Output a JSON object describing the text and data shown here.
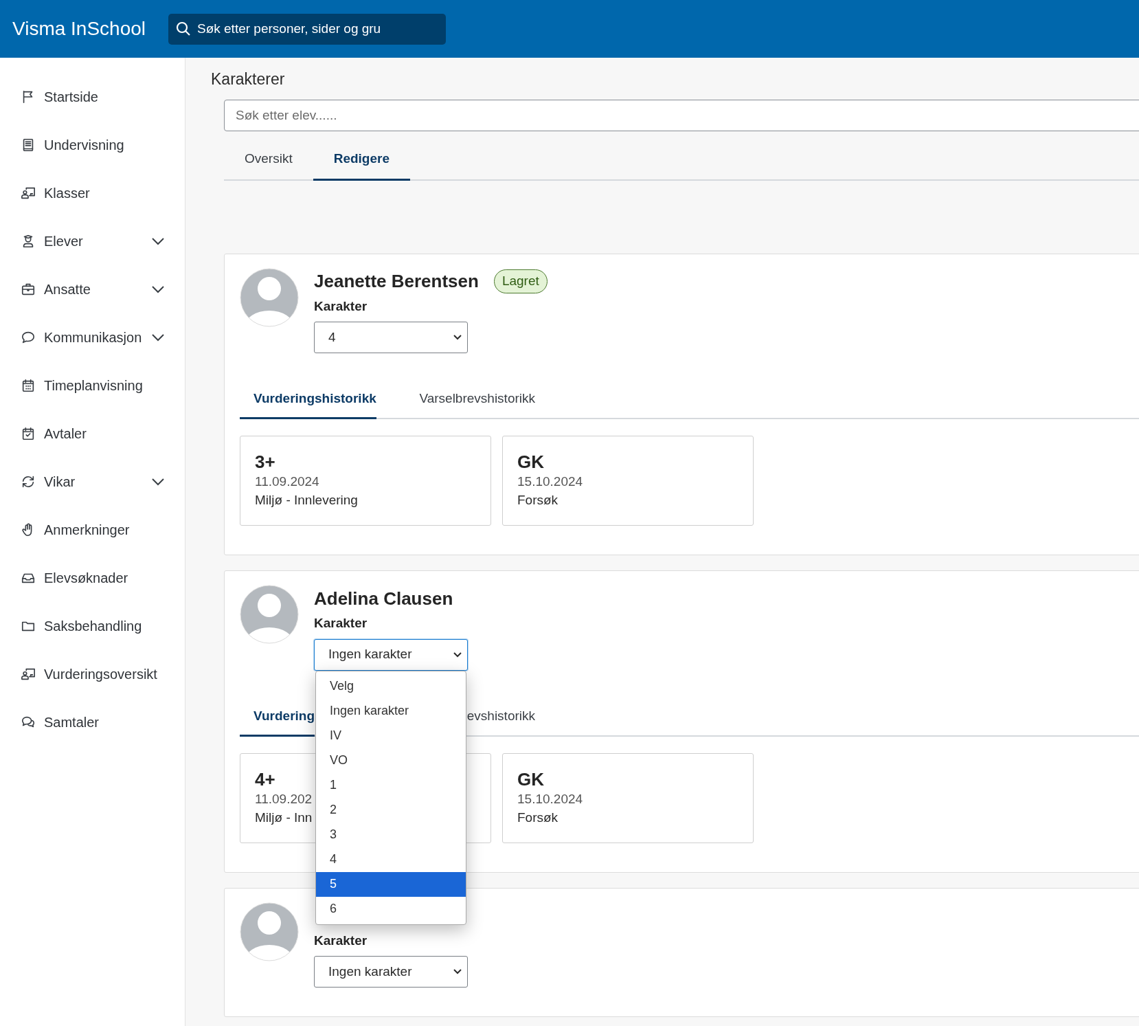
{
  "header": {
    "app_title": "Visma InSchool",
    "search": {
      "placeholder": "Søk etter personer, sider og gru"
    }
  },
  "sidebar": {
    "items": [
      {
        "label": "Startside",
        "has_children": false
      },
      {
        "label": "Undervisning",
        "has_children": false
      },
      {
        "label": "Klasser",
        "has_children": false
      },
      {
        "label": "Elever",
        "has_children": true
      },
      {
        "label": "Ansatte",
        "has_children": true
      },
      {
        "label": "Kommunikasjon",
        "has_children": true
      },
      {
        "label": "Timeplanvisning",
        "has_children": false
      },
      {
        "label": "Avtaler",
        "has_children": false
      },
      {
        "label": "Vikar",
        "has_children": true
      },
      {
        "label": "Anmerkninger",
        "has_children": false
      },
      {
        "label": "Elevsøknader",
        "has_children": false
      },
      {
        "label": "Saksbehandling",
        "has_children": false
      },
      {
        "label": "Vurderingsoversikt",
        "has_children": false
      },
      {
        "label": "Samtaler",
        "has_children": false
      }
    ]
  },
  "page": {
    "title": "Karakterer",
    "search": {
      "placeholder": "Søk etter elev......"
    },
    "tabs": [
      {
        "label": "Oversikt",
        "selected": false
      },
      {
        "label": "Redigere",
        "selected": true
      }
    ]
  },
  "students": [
    {
      "name": "Jeanette Berentsen",
      "badge": "Lagret",
      "grade_label": "Karakter",
      "grade_value": "4",
      "focused": false,
      "history_tabs": [
        {
          "label": "Vurderingshistorikk",
          "selected": true
        },
        {
          "label": "Varselbrevshistorikk",
          "selected": false
        }
      ],
      "history": [
        {
          "grade": "3+",
          "date": "11.09.2024",
          "description": "Miljø - Innlevering"
        },
        {
          "grade": "GK",
          "date": "15.10.2024",
          "description": "Forsøk"
        }
      ]
    },
    {
      "name": "Adelina Clausen",
      "grade_label": "Karakter",
      "grade_value": "Ingen karakter",
      "focused": true,
      "dropdown": [
        {
          "label": "Velg",
          "selected": false
        },
        {
          "label": "Ingen karakter",
          "selected": false
        },
        {
          "label": "IV",
          "selected": false
        },
        {
          "label": "VO",
          "selected": false
        },
        {
          "label": "1",
          "selected": false
        },
        {
          "label": "2",
          "selected": false
        },
        {
          "label": "3",
          "selected": false
        },
        {
          "label": "4",
          "selected": false
        },
        {
          "label": "5",
          "selected": true
        },
        {
          "label": "6",
          "selected": false
        }
      ],
      "history_tabs": [
        {
          "label": "Vurdering",
          "selected": true
        },
        {
          "label": "evshistorikk",
          "selected": false
        }
      ],
      "history": [
        {
          "grade": "4+",
          "date": "11.09.202",
          "description": "Miljø - Inn"
        },
        {
          "grade": "GK",
          "date": "15.10.2024",
          "description": "Forsøk"
        }
      ]
    },
    {
      "grade_label": "Karakter",
      "grade_value": "Ingen karakter",
      "focused": false
    }
  ]
}
